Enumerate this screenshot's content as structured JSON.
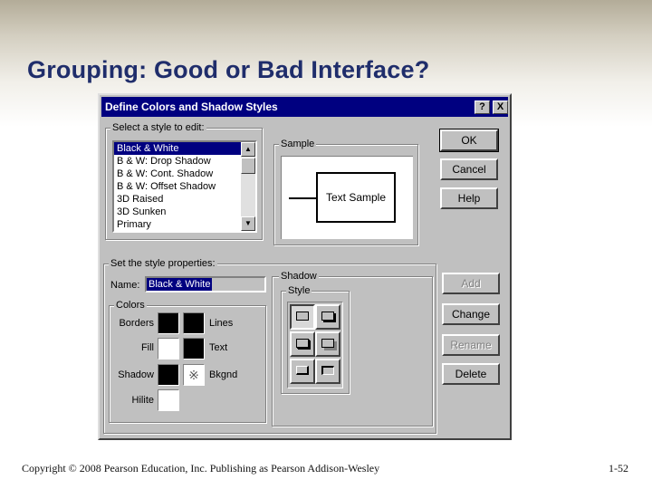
{
  "slide": {
    "title": "Grouping: Good or Bad Interface?",
    "footer_left": "Copyright © 2008 Pearson Education, Inc. Publishing as Pearson Addison-Wesley",
    "footer_right": "1-52"
  },
  "dialog": {
    "title": "Define Colors and Shadow Styles",
    "help_glyph": "?",
    "close_glyph": "X",
    "select_group_label": "Select a style to edit:",
    "style_list": [
      "Black & White",
      "B & W: Drop Shadow",
      "B & W: Cont. Shadow",
      "B & W: Offset Shadow",
      "3D Raised",
      "3D Sunken",
      "Primary"
    ],
    "selected_index": 0,
    "sample_group_label": "Sample",
    "sample_text": "Text Sample",
    "buttons": {
      "ok": "OK",
      "cancel": "Cancel",
      "help": "Help",
      "add": "Add",
      "change": "Change",
      "rename": "Rename",
      "delete": "Delete"
    },
    "properties_group_label": "Set the style properties:",
    "name_label": "Name:",
    "name_value": "Black & White",
    "colors_group_label": "Colors",
    "color_labels": {
      "borders": "Borders",
      "lines": "Lines",
      "fill": "Fill",
      "text": "Text",
      "shadow": "Shadow",
      "bkgnd": "Bkgnd",
      "hilite": "Hilite"
    },
    "shadow_group_label": "Shadow",
    "style_group_label": "Style",
    "scroll_up_glyph": "▲",
    "scroll_down_glyph": "▼",
    "pattern_glyph": "※"
  },
  "colors": {
    "title_text": "#1f2d6b",
    "dialog_titlebar": "#000080",
    "dialog_face": "#c0c0c0"
  }
}
